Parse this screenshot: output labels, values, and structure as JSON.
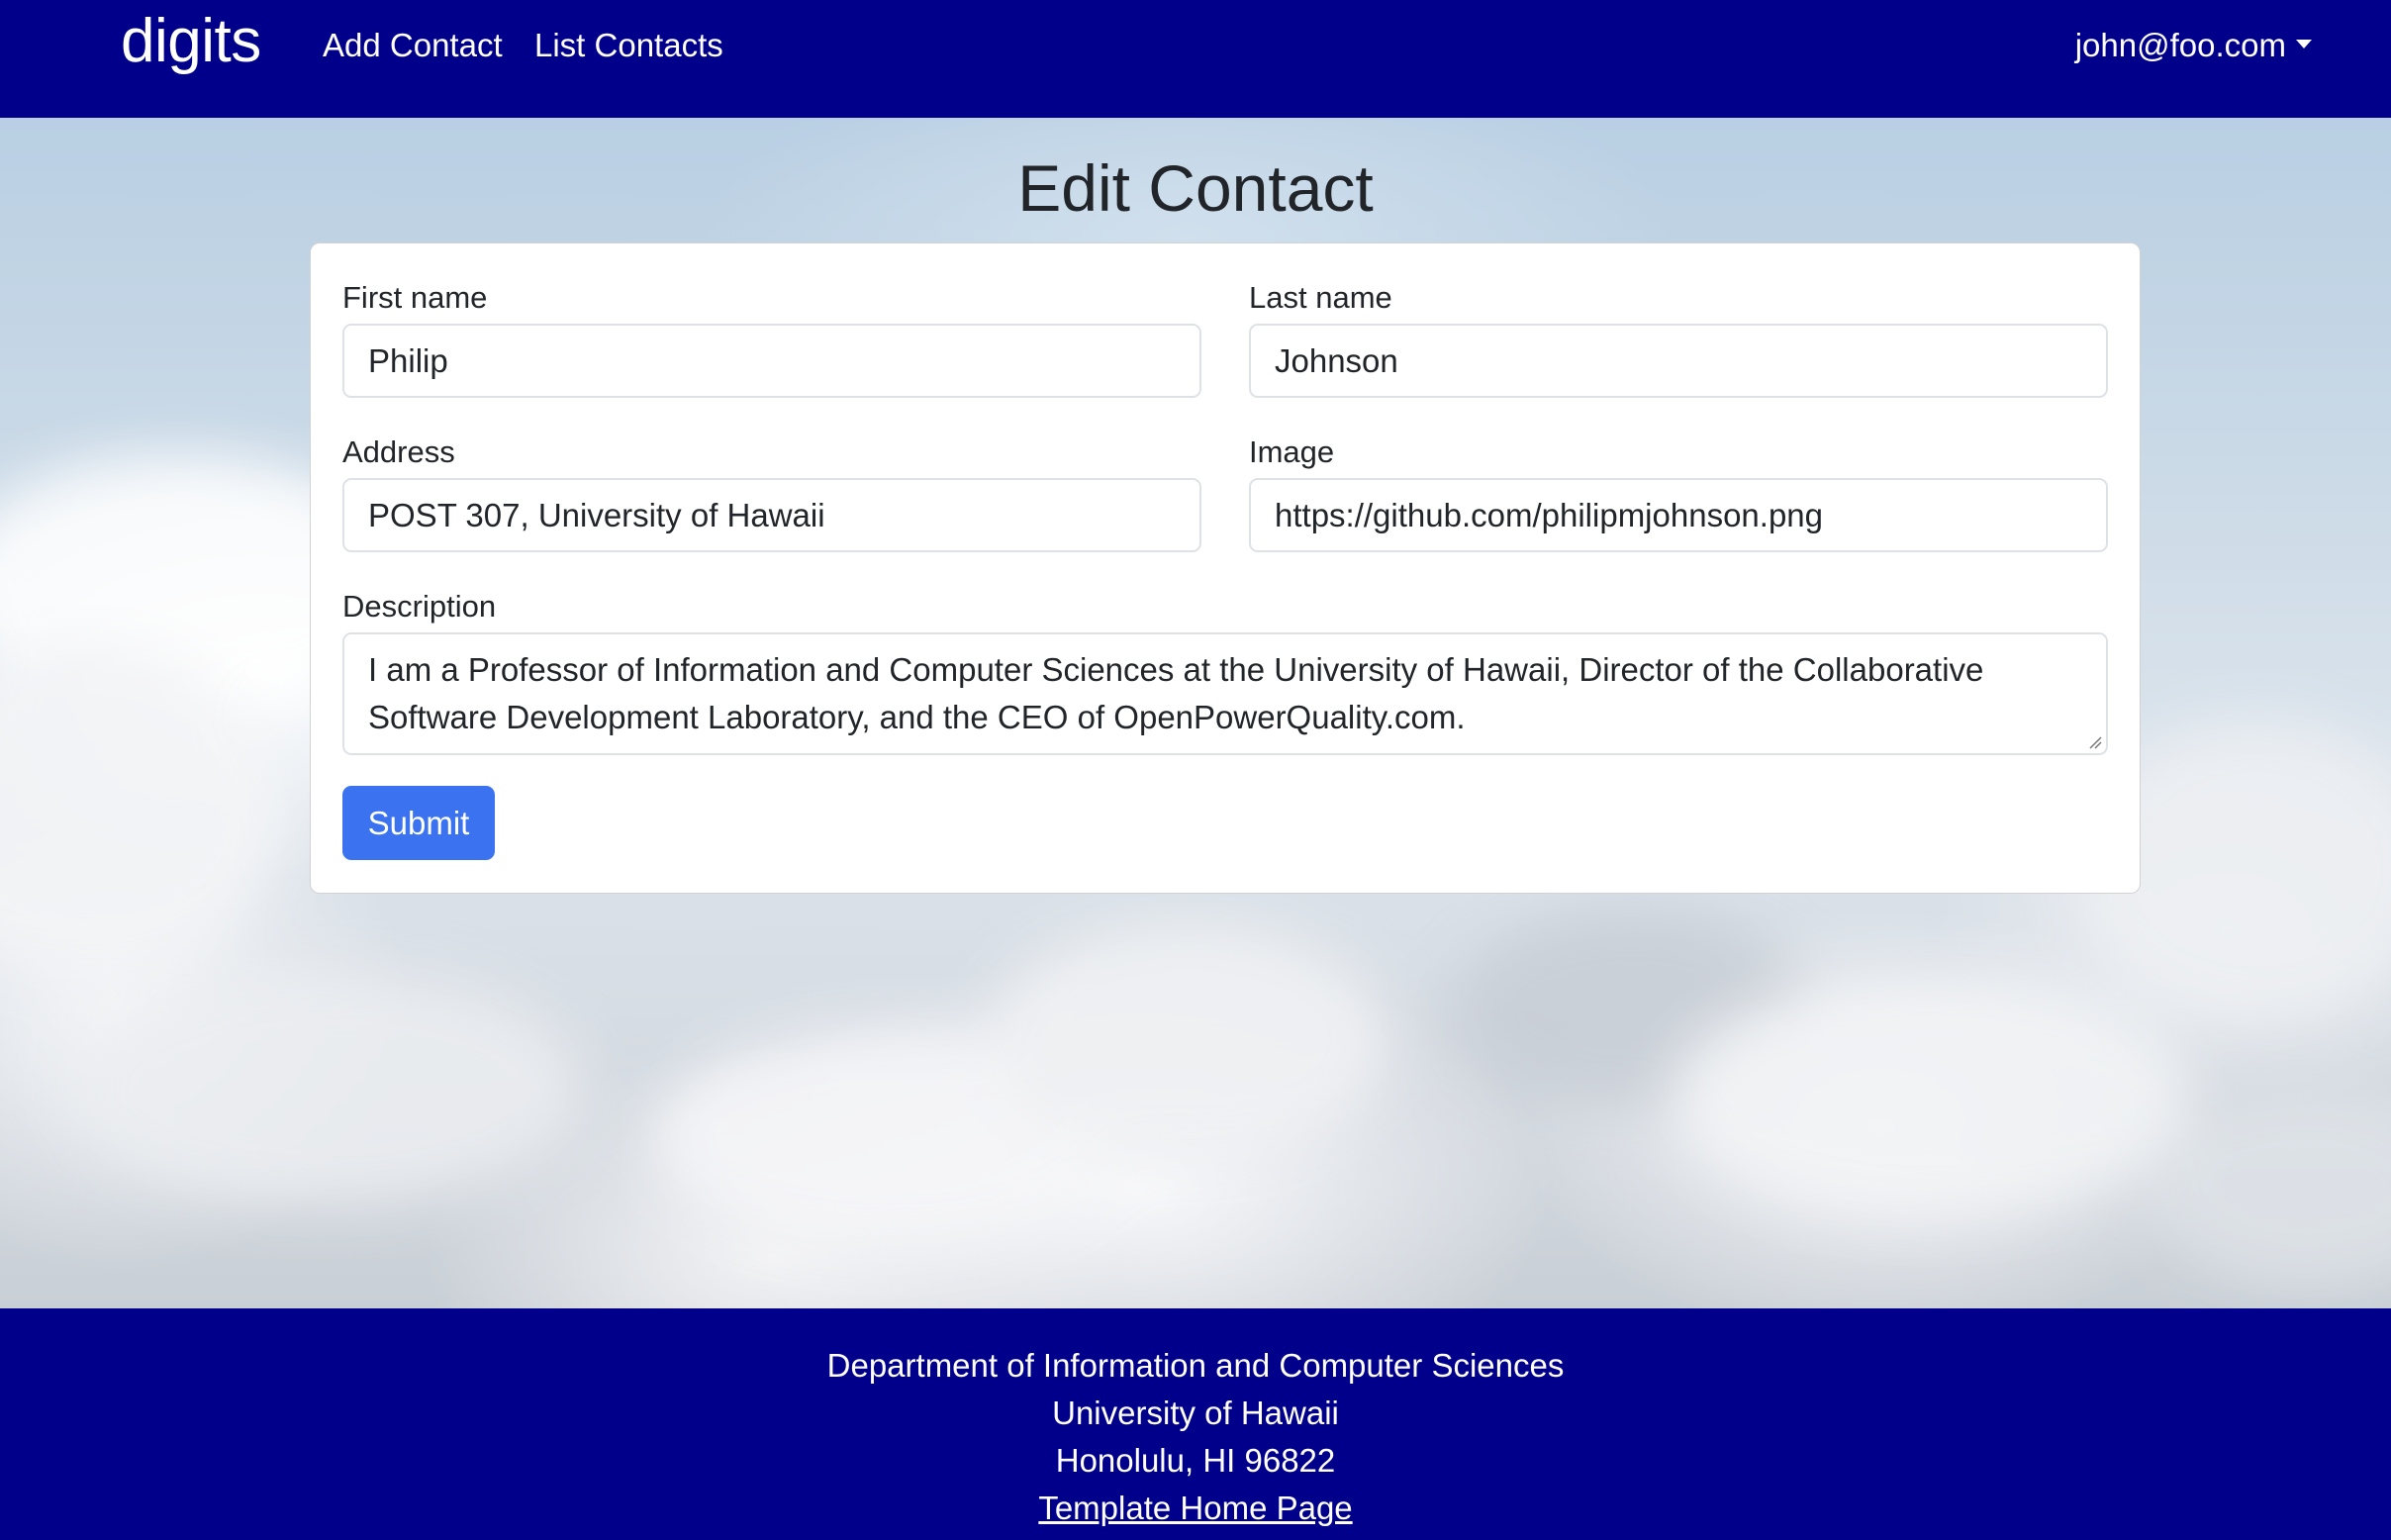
{
  "navbar": {
    "brand": "digits",
    "links": [
      {
        "label": "Add Contact"
      },
      {
        "label": "List Contacts"
      }
    ],
    "user": "john@foo.com"
  },
  "page": {
    "title": "Edit Contact"
  },
  "form": {
    "first_name": {
      "label": "First name",
      "value": "Philip"
    },
    "last_name": {
      "label": "Last name",
      "value": "Johnson"
    },
    "address": {
      "label": "Address",
      "value": "POST 307, University of Hawaii"
    },
    "image": {
      "label": "Image",
      "value": "https://github.com/philipmjohnson.png"
    },
    "description": {
      "label": "Description",
      "value_line1": "I am a Professor of Information and Computer Sciences at the University of Hawaii, Director of the Collaborative",
      "value_line2": "Software Development Laboratory, and the CEO of OpenPowerQuality.com."
    },
    "submit_label": "Submit"
  },
  "footer": {
    "line1": "Department of Information and Computer Sciences",
    "line2": "University of Hawaii",
    "line3": "Honolulu, HI 96822",
    "link": "Template Home Page"
  },
  "colors": {
    "navbar_bg": "#00008b",
    "footer_bg": "#00008b",
    "submit_bg": "#3a72f0"
  }
}
